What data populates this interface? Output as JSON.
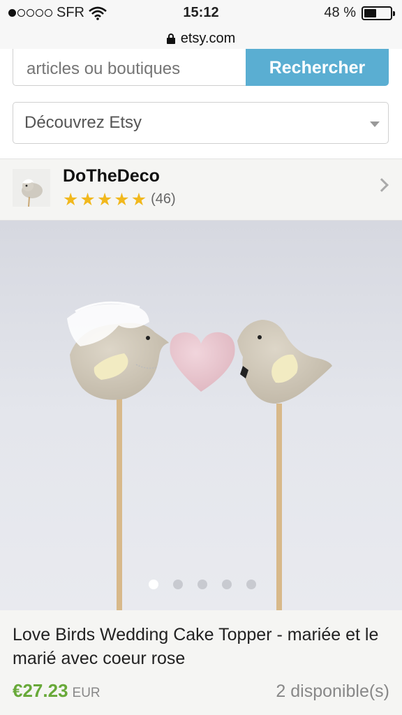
{
  "status_bar": {
    "carrier": "SFR",
    "time": "15:12",
    "battery_text": "48 %",
    "battery_level": 0.48,
    "signal_bars_filled": 1
  },
  "url_bar": {
    "domain": "etsy.com"
  },
  "search": {
    "placeholder": "articles ou boutiques",
    "button_label": "Rechercher",
    "accent_color": "#5aaed2"
  },
  "discover": {
    "selected": "Découvrez Etsy"
  },
  "shop": {
    "name": "DoTheDeco",
    "rating_stars": 5,
    "review_count": "(46)",
    "star_color": "#f1b81d"
  },
  "gallery": {
    "image_count": 5,
    "active_index": 0
  },
  "listing": {
    "title": "Love Birds Wedding Cake Topper - mariée et le marié avec coeur rose",
    "price": "€27.23",
    "currency": "EUR",
    "availability": "2 disponible(s)",
    "price_color": "#68a939"
  }
}
